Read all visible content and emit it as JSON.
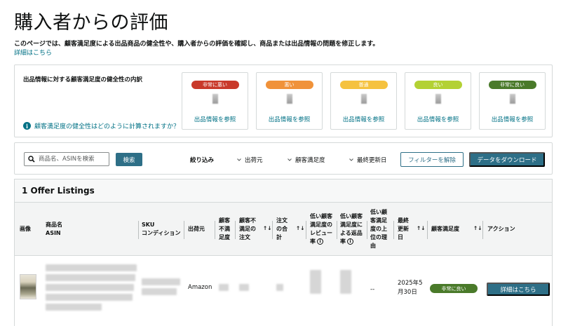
{
  "page": {
    "title": "購入者からの評価",
    "description": "このページでは、顧客満足度による出品商品の健全性や、購入者からの評価を確認し、商品または出品情報の問題を修正します。",
    "details_link": "詳細はこちら"
  },
  "breakdown": {
    "title": "出品情報に対する顧客満足度の健全性の内訳",
    "help_link": "顧客満足度の健全性はどのように計算されますか？",
    "cards": [
      {
        "badge": "非常に悪い",
        "color": "#c9392a",
        "link": "出品情報を参照"
      },
      {
        "badge": "悪い",
        "color": "#f0923a",
        "link": "出品情報を参照"
      },
      {
        "badge": "普通",
        "color": "#f5c23f",
        "link": "出品情報を参照"
      },
      {
        "badge": "良い",
        "color": "#b3d134",
        "link": "出品情報を参照"
      },
      {
        "badge": "非常に良い",
        "color": "#4a7a2a",
        "link": "出品情報を参照"
      }
    ]
  },
  "filters": {
    "search_placeholder": "商品名、ASINを検索",
    "search_button": "検索",
    "refine_label": "絞り込み",
    "dropdowns": [
      "出荷元",
      "顧客満足度",
      "最終更新日"
    ],
    "clear_button": "フィルターを解除",
    "download_button": "データをダウンロード"
  },
  "listings": {
    "header": "1 Offer Listings",
    "columns": {
      "image": "画像",
      "product_name_1": "商品名",
      "product_name_2": "ASIN",
      "sku_1": "SKU",
      "sku_2": "コンディション",
      "fulfilled_by": "出荷元",
      "dissatisfaction_rate": [
        "顧客",
        "不満",
        "足度"
      ],
      "dissatisfied_orders": [
        "顧客不",
        "満足の",
        "注文"
      ],
      "order_total": [
        "注文",
        "の合",
        "計"
      ],
      "low_rating_reviews": [
        "低い顧客",
        "満足度の",
        "レビュー",
        "率"
      ],
      "low_rating_returns": [
        "低い顧客",
        "満足度に",
        "よる返品",
        "率"
      ],
      "top_reason": [
        "低い顧",
        "客満足",
        "度の上",
        "位の理",
        "由"
      ],
      "last_updated": [
        "最終",
        "更新",
        "日"
      ],
      "satisfaction": "顧客満足度",
      "actions": "アクション"
    },
    "rows": [
      {
        "fulfilled_by": "Amazon",
        "top_reason": "--",
        "last_updated_1": "2025年5",
        "last_updated_2": "月30日",
        "satisfaction": "非常に良い",
        "satisfaction_color": "#4a7a2a",
        "action": "詳細はこちら"
      }
    ]
  }
}
